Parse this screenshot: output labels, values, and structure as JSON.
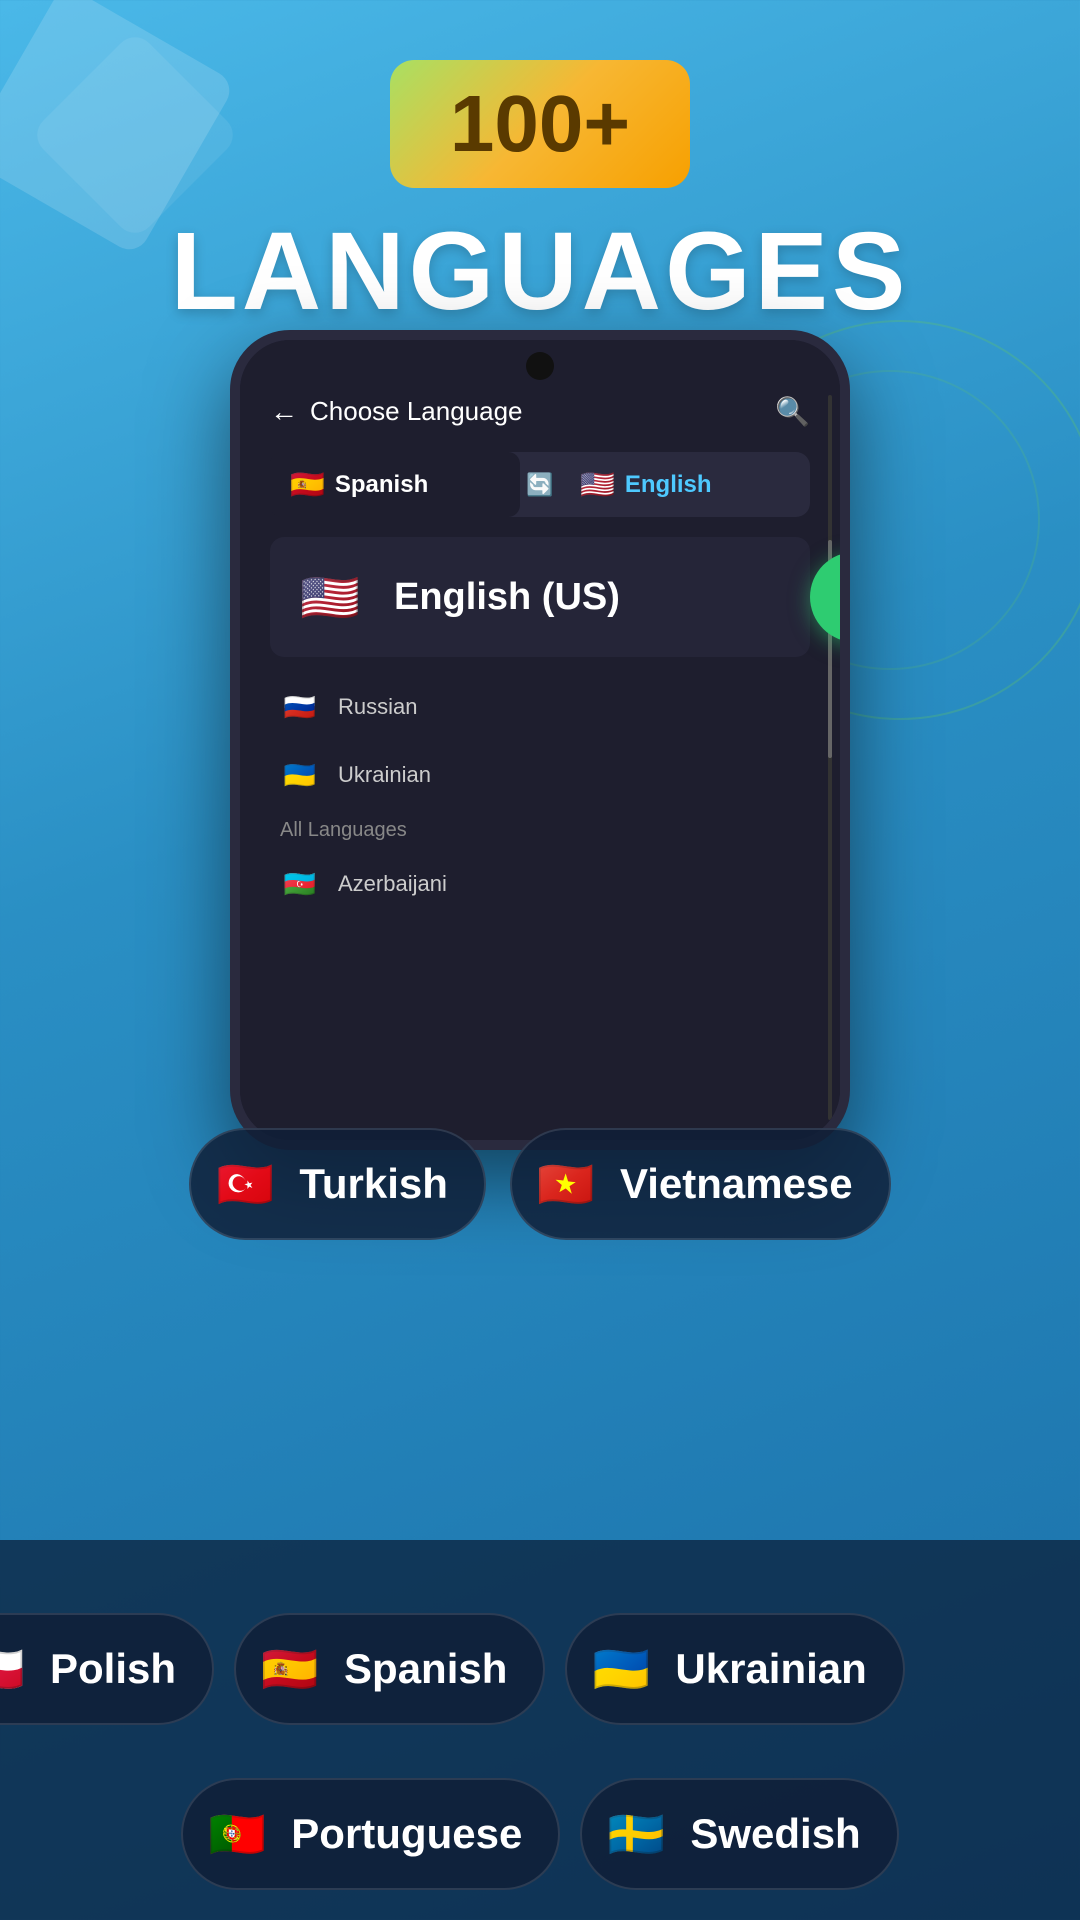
{
  "header": {
    "count_badge": "100+",
    "title": "LANGUAGES"
  },
  "phone": {
    "header": {
      "back_label": "Choose Language",
      "search_icon": "search"
    },
    "tabs": {
      "source_lang": "Spanish",
      "target_lang": "English",
      "swap_icon": "swap"
    },
    "selected_language": "English (US)",
    "language_list": [
      {
        "name": "Russian",
        "flag": "🇷🇺"
      },
      {
        "name": "Ukrainian",
        "flag": "🇺🇦"
      }
    ],
    "section_header": "All Languages",
    "all_languages_first": "Azerbaijani"
  },
  "bottom_pills_row1": [
    {
      "name": "Turkish",
      "flag": "🇹🇷"
    },
    {
      "name": "Vietnamese",
      "flag": "🇻🇳"
    }
  ],
  "bottom_pills_row2": [
    {
      "name": "Polish",
      "flag": "🇵🇱"
    },
    {
      "name": "Spanish",
      "flag": "🇪🇸"
    },
    {
      "name": "Ukrainian",
      "flag": "🇺🇦"
    }
  ],
  "bottom_pills_row3": [
    {
      "name": "Portuguese",
      "flag": "🇵🇹"
    },
    {
      "name": "Swedish",
      "flag": "🇸🇪"
    }
  ],
  "colors": {
    "bg_start": "#4ab8e8",
    "bg_end": "#1a6fa8",
    "phone_bg": "#1e1e2e",
    "badge_gradient": [
      "#a8e063",
      "#f7b733"
    ],
    "check_green": "#2ecc71"
  }
}
